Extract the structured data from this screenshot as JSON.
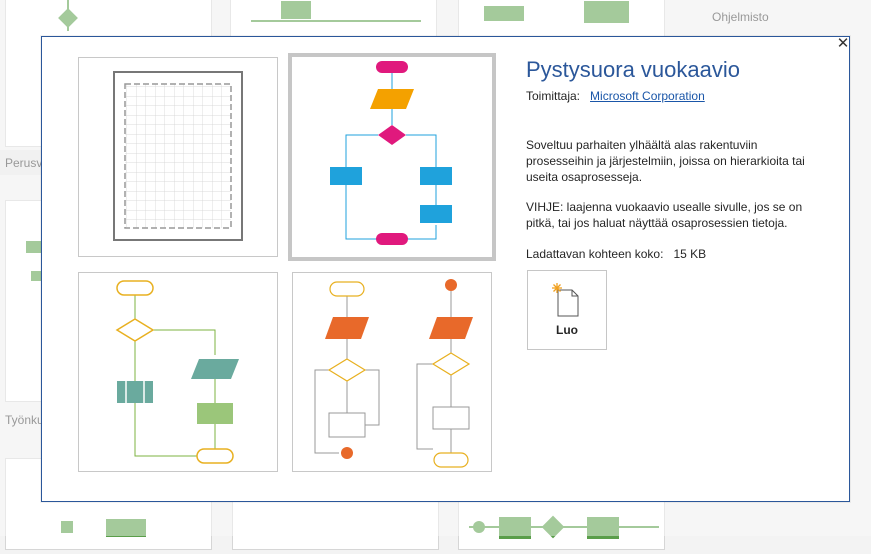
{
  "background": {
    "labels": [
      "Ohjelmisto",
      "Perusv",
      "Työnku"
    ]
  },
  "dialog": {
    "close_glyph": "✕",
    "title": "Pystysuora vuokaavio",
    "publisher_label": "Toimittaja:",
    "publisher_name": "Microsoft Corporation",
    "description": "Soveltuu parhaiten ylhäältä alas rakentuviin prosesseihin ja järjestelmiin, joissa on hierarkioita tai useita osaprosesseja.",
    "hint": "VIHJE: laajenna vuokaavio usealle sivulle, jos se on pitkä, tai jos haluat näyttää osaprosessien tietoja.",
    "size_label": "Ladattavan kohteen koko:",
    "size_value": "15 KB",
    "create_label": "Luo",
    "create_icon": "new-document-icon",
    "thumbnails": [
      {
        "name": "blank-grid-template"
      },
      {
        "name": "vertical-flowchart-color",
        "selected": true
      },
      {
        "name": "vertical-flowchart-green"
      },
      {
        "name": "vertical-flowchart-orange"
      }
    ]
  },
  "colors": {
    "accent": "#2b579a",
    "link": "#1a56a8",
    "magenta": "#e0197d",
    "orange": "#f4a100",
    "blue": "#1fa2dc",
    "green_line": "#7cb342",
    "teal": "#6aaa9e",
    "light_green": "#9bc67a",
    "yellow_outline": "#e8b020",
    "deep_orange": "#e8692a"
  }
}
